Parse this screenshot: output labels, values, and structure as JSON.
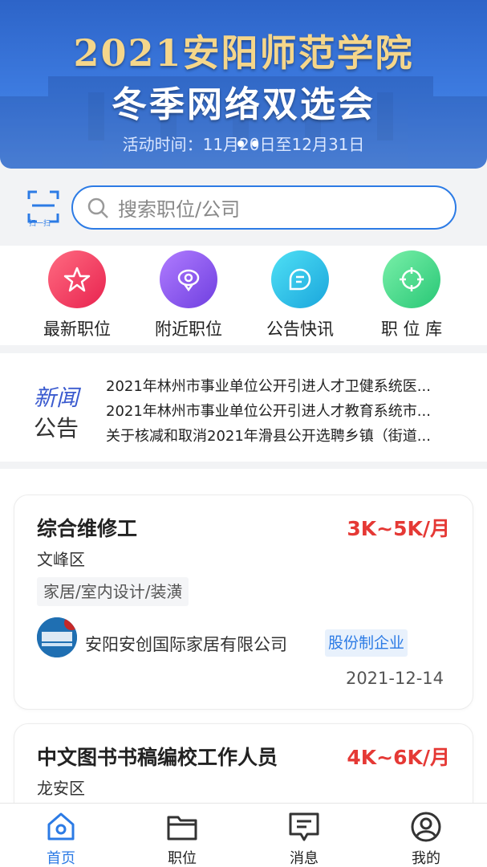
{
  "banner": {
    "title_line1": "2021安阳师范学院",
    "title_line2": "冬季网络双选会",
    "subtitle": "活动时间：11月20日至12月31日"
  },
  "search": {
    "scan_label": "扫一扫",
    "placeholder": "搜索职位/公司"
  },
  "menu": [
    {
      "label": "最新职位",
      "icon": "star-icon",
      "color": "#f0385f"
    },
    {
      "label": "附近职位",
      "icon": "location-icon",
      "color": "#8f5cf0"
    },
    {
      "label": "公告快讯",
      "icon": "message-icon",
      "color": "#2ac2e8"
    },
    {
      "label": "职 位 库",
      "icon": "target-icon",
      "color": "#3ed48a"
    }
  ],
  "news": {
    "tag_line1": "新闻",
    "tag_line2": "公告",
    "items": [
      "2021年林州市事业单位公开引进人才卫健系统医...",
      "2021年林州市事业单位公开引进人才教育系统市...",
      "关于核减和取消2021年滑县公开选聘乡镇（街道..."
    ]
  },
  "jobs": [
    {
      "title": "综合维修工",
      "salary": "3K~5K/月",
      "area": "文峰区",
      "tag": "家居/室内设计/装潢",
      "company": "安阳安创国际家居有限公司",
      "company_type": "股份制企业",
      "date": "2021-12-14"
    },
    {
      "title": "中文图书书稿编校工作人员",
      "salary": "4K~6K/月",
      "area": "龙安区"
    }
  ],
  "tabs": [
    {
      "label": "首页",
      "icon": "home-icon",
      "active": true
    },
    {
      "label": "职位",
      "icon": "folder-icon",
      "active": false
    },
    {
      "label": "消息",
      "icon": "chat-icon",
      "active": false
    },
    {
      "label": "我的",
      "icon": "user-icon",
      "active": false
    }
  ],
  "colors": {
    "accent": "#2c7be5",
    "salary": "#e53935",
    "banner_gold": "#f5d68a"
  }
}
